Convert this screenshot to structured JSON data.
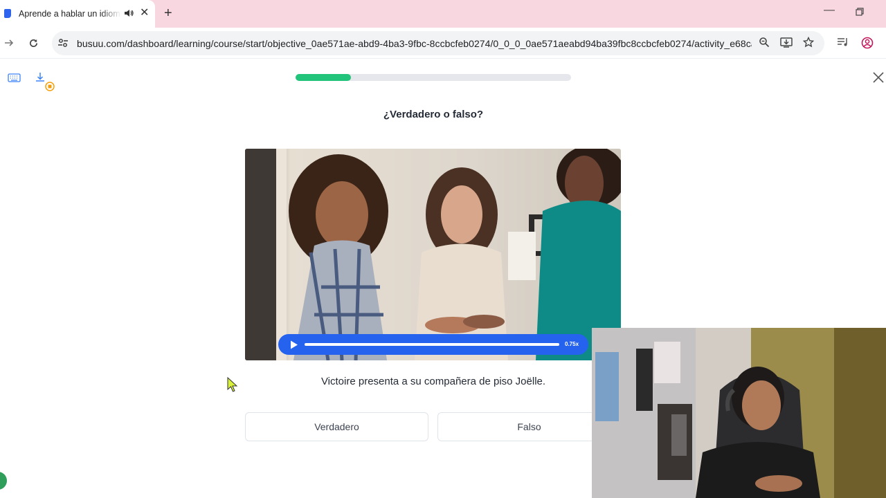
{
  "browser": {
    "tab_title": "Aprende a hablar un idioma",
    "url": "busuu.com/dashboard/learning/course/start/objective_0ae571ae-abd9-4ba3-9fbc-8ccbcfeb0274/0_0_0_0ae571aeabd94ba39fbc8ccbcfeb0274/activity_e68ca..."
  },
  "lesson": {
    "progress": 0.2,
    "question": "¿Verdadero o falso?",
    "audio_speed": "0.75x",
    "statement": "Victoire presenta a su compañera de piso Joëlle.",
    "answers": {
      "true_label": "Verdadero",
      "false_label": "Falso"
    }
  },
  "colors": {
    "progress_fill": "#21c47a",
    "audio_bar": "#2563ef",
    "tabbar": "#f8d7e0"
  }
}
